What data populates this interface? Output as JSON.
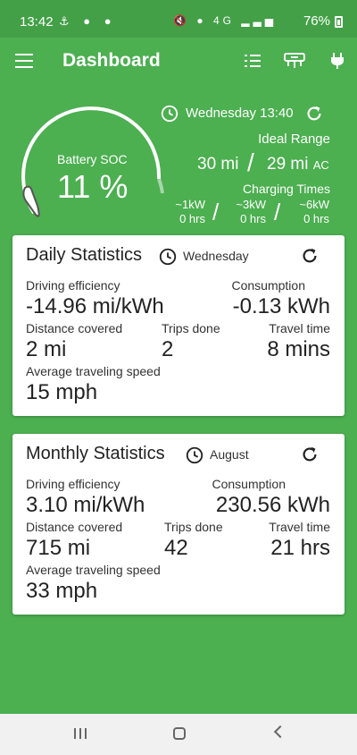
{
  "statusbar": {
    "time": "13:42",
    "battery_percent": "76%",
    "net_label": "4G"
  },
  "appbar": {
    "title": "Dashboard"
  },
  "header": {
    "soc_label": "Battery SOC",
    "soc_value": "11 %",
    "soc_fraction": 0.11,
    "datetime": "Wednesday 13:40",
    "ideal_range_label": "Ideal Range",
    "range_mi": "30 mi",
    "range_sep": "/",
    "range_ac_value": "29 mi",
    "range_ac_suffix": "AC",
    "charging_times_label": "Charging Times",
    "charging": [
      {
        "power": "~1kW",
        "time": "0 hrs"
      },
      {
        "power": "~3kW",
        "time": "0 hrs"
      },
      {
        "power": "~6kW",
        "time": "0 hrs"
      }
    ]
  },
  "daily": {
    "title": "Daily Statistics",
    "period": "Wednesday",
    "driving_efficiency_label": "Driving efficiency",
    "driving_efficiency": "-14.96 mi/kWh",
    "consumption_label": "Consumption",
    "consumption": "-0.13 kWh",
    "distance_label": "Distance covered",
    "distance": "2 mi",
    "trips_label": "Trips done",
    "trips": "2",
    "travel_time_label": "Travel time",
    "travel_time": "8 mins",
    "avg_speed_label": "Average traveling speed",
    "avg_speed": "15 mph"
  },
  "monthly": {
    "title": "Monthly Statistics",
    "period": "August",
    "driving_efficiency_label": "Driving efficiency",
    "driving_efficiency": "3.10 mi/kWh",
    "consumption_label": "Consumption",
    "consumption": "230.56 kWh",
    "distance_label": "Distance covered",
    "distance": "715 mi",
    "trips_label": "Trips done",
    "trips": "42",
    "travel_time_label": "Travel time",
    "travel_time": "21 hrs",
    "avg_speed_label": "Average traveling speed",
    "avg_speed": "33 mph"
  },
  "colors": {
    "primary": "#4caf50",
    "statusbar": "#43a047",
    "card": "#ffffff",
    "navbar": "#f1f1f1"
  }
}
